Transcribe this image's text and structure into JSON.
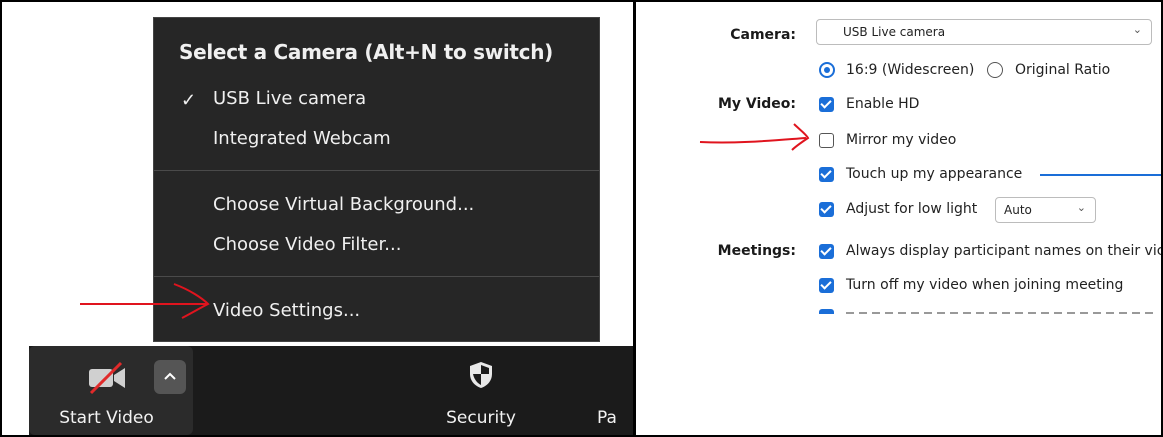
{
  "camera_menu": {
    "title": "Select a Camera (Alt+N to switch)",
    "cameras": [
      "USB  Live camera",
      "Integrated Webcam"
    ],
    "selected_mark": "✓",
    "options": [
      "Choose Virtual Background...",
      "Choose Video Filter..."
    ],
    "video_settings": "Video Settings..."
  },
  "toolbar": {
    "start_video_label": "Start Video",
    "security_label": "Security",
    "participants_partial": "Pa"
  },
  "settings": {
    "camera_label": "Camera:",
    "camera_value": "USB  Live camera",
    "ratio_widescreen": "16:9 (Widescreen)",
    "ratio_original": "Original Ratio",
    "my_video_label": "My Video:",
    "enable_hd": "Enable HD",
    "mirror_video": "Mirror my video",
    "touch_up": "Touch up my appearance",
    "low_light": "Adjust for low light",
    "low_light_mode": "Auto",
    "meetings_label": "Meetings:",
    "display_names": "Always display participant names on their vic",
    "turn_off_video": "Turn off my video when joining meeting"
  },
  "colors": {
    "accent": "#1a6ed8",
    "annotation_red": "#e0141e",
    "menu_bg": "#262626"
  }
}
